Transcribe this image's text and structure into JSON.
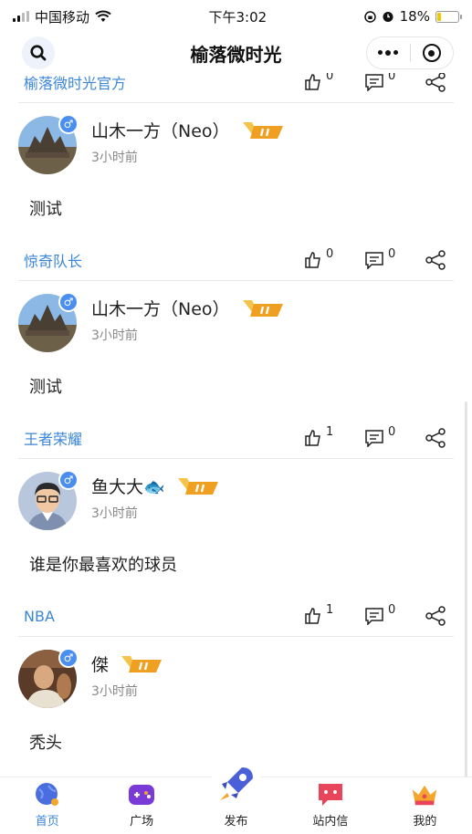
{
  "status_bar": {
    "carrier": "中国移动",
    "time": "下午3:02",
    "battery": "18%",
    "battery_level": 0.18
  },
  "nav": {
    "title": "榆落微时光"
  },
  "top_footer": {
    "topic": "榆落微时光官方",
    "likes": "0",
    "comments": "0"
  },
  "posts": [
    {
      "name": "山木一方（Neo）",
      "time": "3小时前",
      "content": "测试",
      "topic": "惊奇队长",
      "likes": "0",
      "comments": "0"
    },
    {
      "name": "山木一方（Neo）",
      "time": "3小时前",
      "content": "测试",
      "topic": "王者荣耀",
      "likes": "1",
      "comments": "0"
    },
    {
      "name": "鱼大大🐟",
      "time": "3小时前",
      "content": "谁是你最喜欢的球员",
      "topic": "NBA",
      "likes": "1",
      "comments": "0"
    },
    {
      "name": "傑",
      "time": "3小时前",
      "content": "秃头"
    }
  ],
  "tabs": [
    {
      "label": "首页",
      "icon": "home-globe-icon"
    },
    {
      "label": "广场",
      "icon": "gamepad-icon"
    },
    {
      "label": "发布",
      "icon": "rocket-icon"
    },
    {
      "label": "站内信",
      "icon": "message-icon"
    },
    {
      "label": "我的",
      "icon": "crown-icon"
    }
  ],
  "colors": {
    "accent": "#3b86d8",
    "gender_badge": "#4a8ef0",
    "vip_badge": "#f0a020"
  }
}
